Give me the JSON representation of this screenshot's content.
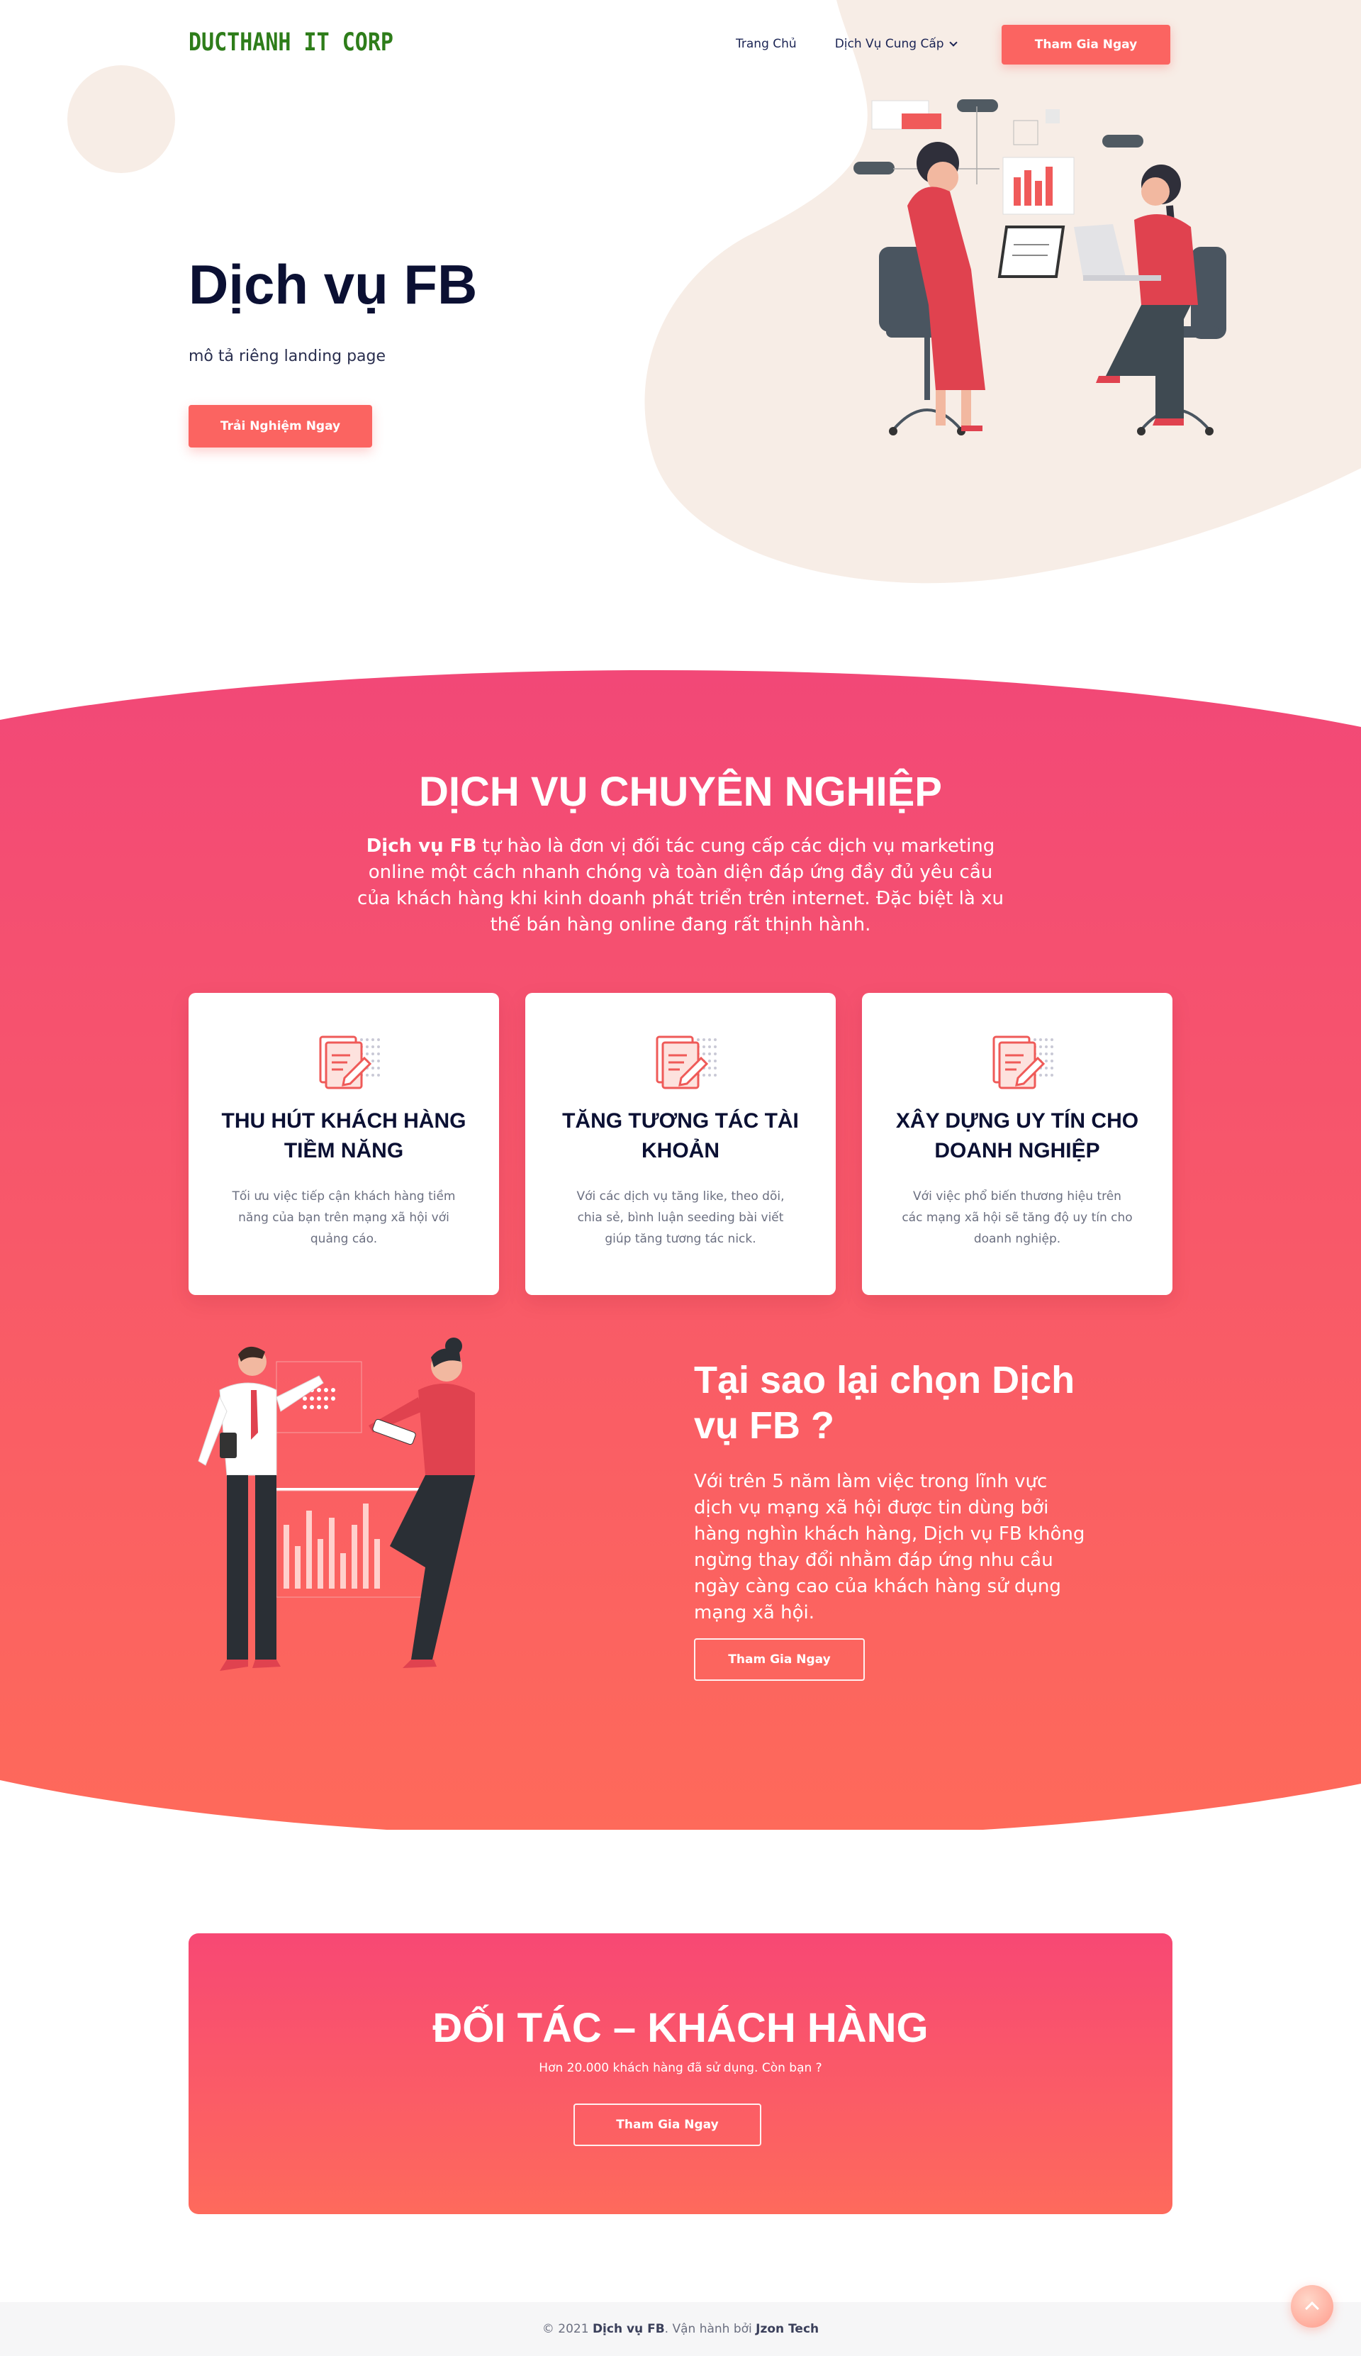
{
  "header": {
    "logo": "DUCTHANH IT CORP",
    "nav_home": "Trang Chủ",
    "nav_services": "Dịch Vụ Cung Cấp",
    "cta": "Tham Gia Ngay"
  },
  "hero": {
    "title": "Dịch vụ FB",
    "description": "mô tả riêng landing page",
    "cta": "Trải Nghiệm Ngay"
  },
  "services": {
    "title": "DỊCH VỤ CHUYÊN NGHIỆP",
    "intro_brand": "Dịch vụ FB",
    "intro_text": " tự hào là đơn vị đối tác cung cấp các dịch vụ marketing online một cách nhanh chóng và toàn diện đáp ứng đầy đủ yêu cầu của khách hàng khi kinh doanh phát triển trên internet. Đặc biệt là xu thế bán hàng online đang rất thịnh hành.",
    "cards": [
      {
        "title": "THU HÚT KHÁCH HÀNG TIỀM NĂNG",
        "description": "Tối ưu việc tiếp cận khách hàng tiềm năng của bạn trên mạng xã hội với quảng cáo."
      },
      {
        "title": "TĂNG TƯƠNG TÁC TÀI KHOẢN",
        "description": "Với các dịch vụ tăng like, theo dõi, chia sẻ, bình luận seeding bài viết giúp tăng tương tác nick."
      },
      {
        "title": "XÂY DỰNG UY TÍN CHO DOANH NGHIỆP",
        "description": "Với việc phổ biến thương hiệu trên các mạng xã hội sẽ tăng độ uy tín cho doanh nghiệp."
      }
    ]
  },
  "why": {
    "title": "Tại sao lại chọn Dịch vụ FB ?",
    "description": "Với trên 5 năm làm việc trong lĩnh vực dịch vụ mạng xã hội được tin dùng bởi hàng nghìn khách hàng, Dịch vụ FB không ngừng thay đổi nhằm đáp ứng nhu cầu ngày càng cao của khách hàng sử dụng mạng xã hội.",
    "cta": "Tham Gia Ngay"
  },
  "partner": {
    "title": "ĐỐI TÁC – KHÁCH HÀNG",
    "subtitle": "Hơn 20.000 khách hàng đã sử dụng. Còn bạn ?",
    "cta": "Tham Gia Ngay"
  },
  "footer": {
    "prefix": "© 2021 ",
    "brand": "Dịch vụ FB",
    "middle": ". Vận hành bởi ",
    "operator": "Jzon Tech"
  },
  "colors": {
    "accent": "#fb6461",
    "gradient_top": "#f24877",
    "gradient_bottom": "#fe6a5a",
    "hero_blob": "#f7ede6",
    "logo": "#2e7d1a"
  }
}
